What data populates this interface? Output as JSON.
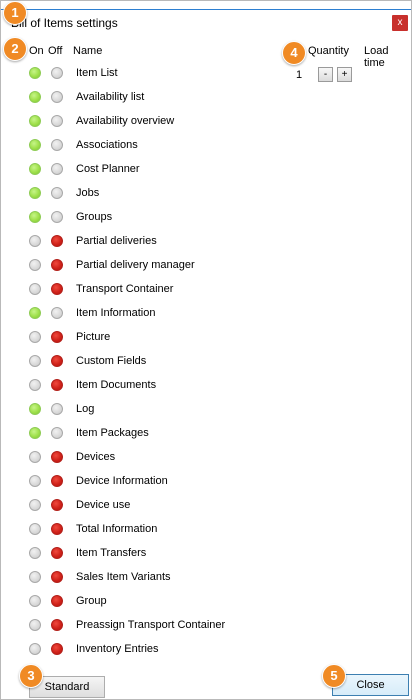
{
  "window": {
    "title": "Bill of Items settings",
    "close_glyph": "x"
  },
  "columns": {
    "on": "On",
    "off": "Off",
    "name": "Name",
    "quantity": "Quantity",
    "load_time": "Load time"
  },
  "quantity": {
    "value": "1",
    "decrement": "-",
    "increment": "+"
  },
  "items": [
    {
      "label": "Item List",
      "state": "on"
    },
    {
      "label": "Availability list",
      "state": "on"
    },
    {
      "label": "Availability overview",
      "state": "on"
    },
    {
      "label": "Associations",
      "state": "on"
    },
    {
      "label": "Cost Planner",
      "state": "on"
    },
    {
      "label": "Jobs",
      "state": "on"
    },
    {
      "label": "Groups",
      "state": "on"
    },
    {
      "label": "Partial deliveries",
      "state": "off"
    },
    {
      "label": "Partial delivery manager",
      "state": "off"
    },
    {
      "label": "Transport Container",
      "state": "off"
    },
    {
      "label": "Item Information",
      "state": "on"
    },
    {
      "label": "Picture",
      "state": "off"
    },
    {
      "label": "Custom Fields",
      "state": "off"
    },
    {
      "label": "Item Documents",
      "state": "off"
    },
    {
      "label": "Log",
      "state": "on"
    },
    {
      "label": "Item Packages",
      "state": "on"
    },
    {
      "label": "Devices",
      "state": "off"
    },
    {
      "label": "Device Information",
      "state": "off"
    },
    {
      "label": "Device use",
      "state": "off"
    },
    {
      "label": "Total Information",
      "state": "off"
    },
    {
      "label": "Item Transfers",
      "state": "off"
    },
    {
      "label": "Sales Item Variants",
      "state": "off"
    },
    {
      "label": "Group",
      "state": "off"
    },
    {
      "label": "Preassign Transport Container",
      "state": "off"
    },
    {
      "label": "Inventory Entries",
      "state": "off"
    }
  ],
  "badges": [
    "1",
    "2",
    "3",
    "4",
    "5"
  ],
  "buttons": {
    "standard": "Standard",
    "close": "Close"
  },
  "colors": {
    "on_indicator": "#9fe04a",
    "off_indicator": "#d0221a",
    "inactive_indicator": "#d8d8d8",
    "badge": "#f08a24",
    "close_x": "#c8302c"
  }
}
